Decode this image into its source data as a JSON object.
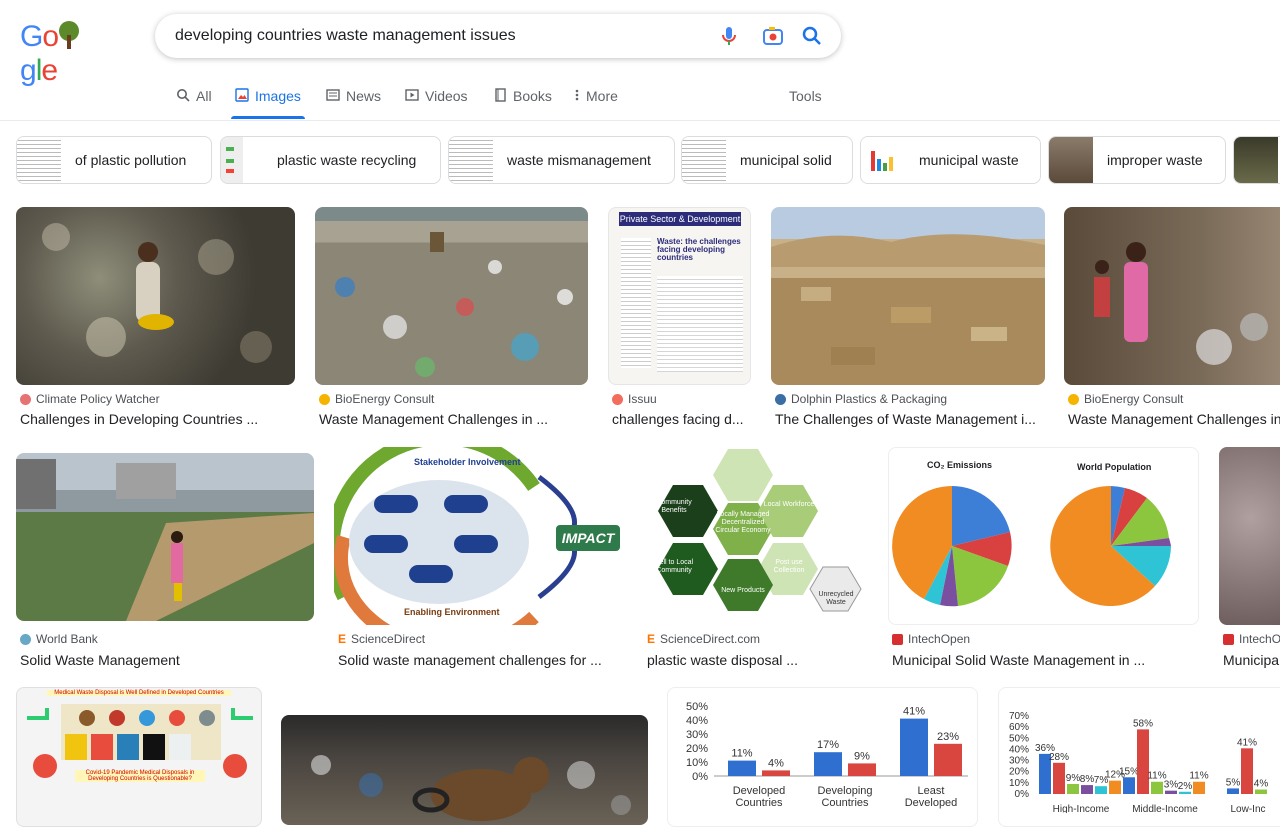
{
  "search": {
    "query": "developing countries waste management issues"
  },
  "tabs": [
    {
      "label": "All",
      "icon": "search-icon"
    },
    {
      "label": "Images",
      "icon": "image-icon"
    },
    {
      "label": "News",
      "icon": "news-icon"
    },
    {
      "label": "Videos",
      "icon": "video-icon"
    },
    {
      "label": "Books",
      "icon": "book-icon"
    },
    {
      "label": "More",
      "icon": "more-vert-icon"
    }
  ],
  "tools_label": "Tools",
  "chips": [
    "of plastic pollution",
    "plastic waste recycling",
    "waste mismanagement",
    "municipal solid",
    "municipal waste",
    "improper waste"
  ],
  "results": [
    {
      "source": "Climate Policy Watcher",
      "title": "Challenges in Developing Countries ..."
    },
    {
      "source": "BioEnergy Consult",
      "title": "Waste Management Challenges in ..."
    },
    {
      "source": "Issuu",
      "title": "challenges facing d..."
    },
    {
      "source": "Dolphin Plastics & Packaging",
      "title": "The Challenges of Waste Management i..."
    },
    {
      "source": "BioEnergy Consult",
      "title": "Waste Management Challenges in"
    },
    {
      "source": "World Bank",
      "title": "Solid Waste Management"
    },
    {
      "source": "ScienceDirect",
      "title": "Solid waste management challenges for ..."
    },
    {
      "source": "ScienceDirect.com",
      "title": "plastic waste disposal ..."
    },
    {
      "source": "IntechOpen",
      "title": "Municipal Solid Waste Management in ..."
    },
    {
      "source": "IntechO",
      "title": "Municipa"
    }
  ],
  "thumbs": {
    "issuu_header": "Private Sector & Development",
    "issuu_title": "Waste: the challenges facing developing countries",
    "impact": "IMPACT",
    "stakeholder": "Stakeholder Involvement",
    "enabling": "Enabling Environment",
    "hex": [
      "Community Benefits",
      "Locally Managed Decentralized Circular Economy",
      "Sell to Local Community",
      "New Products",
      "Unrecycled Waste",
      "Post use Collection",
      "Local Workforce"
    ],
    "co2": "CO₂ Emissions",
    "pop": "World Population",
    "medical": "Medical Waste Disposal is Well Defined in Developed Countries",
    "covid": "Covid-19 Pandemic Medical Disposals in Developing Countries is Questionable?",
    "chart1_yticks": [
      "50%",
      "40%",
      "30%",
      "20%",
      "10%",
      "0%"
    ],
    "chart1_cats": [
      "Developed Countries",
      "Developing Countries",
      "Least Developed"
    ],
    "chart1_vals": [
      [
        11,
        4
      ],
      [
        17,
        9
      ],
      [
        41,
        23
      ]
    ],
    "chart2_yticks": [
      "70%",
      "60%",
      "50%",
      "40%",
      "30%",
      "20%",
      "10%",
      "0%"
    ],
    "chart2_labels": [
      "36%",
      "28%",
      "9%",
      "8%",
      "7%",
      "12%",
      "15%",
      "58%",
      "11%",
      "3%",
      "2%",
      "11%",
      "5%",
      "41%",
      "4%"
    ],
    "chart2_cats": [
      "High-Income",
      "Middle-Income",
      "Low-Inc"
    ]
  }
}
